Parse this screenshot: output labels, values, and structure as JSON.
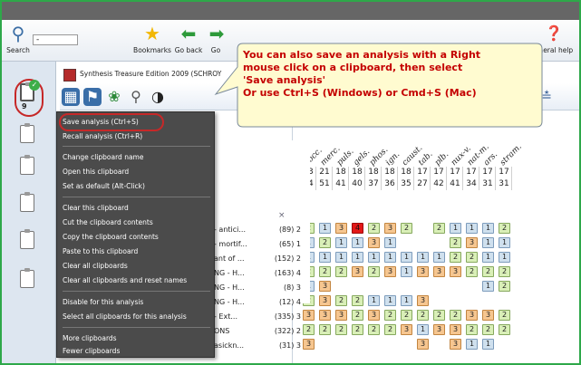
{
  "toolbar": {
    "search_label": "Search",
    "bookmarks_label": "Bookmarks",
    "go_back_label": "Go back",
    "go_label": "Go",
    "general_help_label": "eneral help"
  },
  "document": {
    "title": "Synthesis Treasure Edition 2009 (SCHROY"
  },
  "sidebar": {
    "active_clipboard_count": "9"
  },
  "context_menu": {
    "items": [
      "Save analysis (Ctrl+S)",
      "Recall analysis (Ctrl+R)",
      "Change clipboard name",
      "Open this clipboard",
      "Set as default (Alt-Click)",
      "Clear this clipboard",
      "Cut the clipboard contents",
      "Copy the clipboard contents",
      "Paste to this clipboard",
      "Clear all clipboards",
      "Clear all clipboards and reset names",
      "Disable for this analysis",
      "Select all clipboards for this analysis",
      "More clipboards",
      "Fewer clipboards"
    ]
  },
  "callout": {
    "line1": "You can also save an analysis with a Right",
    "line2": "mouse click on a clipboard, then select",
    "line3": "'Save analysis'",
    "line4": "Or use Ctrl+S (Windows) or Cmd+S (Mac)"
  },
  "remedy_abbrevs": [
    "cocc.",
    "merc.",
    "puls.",
    "gels.",
    "phos.",
    "ign.",
    "caust.",
    "tab.",
    "plb.",
    "nux-v.",
    "nat-m.",
    "ars.",
    "stram."
  ],
  "totals_row": [
    "23",
    "21",
    "18",
    "18",
    "18",
    "18",
    "18",
    "17",
    "17",
    "17",
    "17",
    "17",
    "17"
  ],
  "rubric_count_row": [
    "44",
    "51",
    "41",
    "40",
    "37",
    "36",
    "35",
    "27",
    "42",
    "41",
    "34",
    "31",
    "31"
  ],
  "close_x": "×",
  "rubrics": [
    {
      "name": "- antici...",
      "count": "(89) 2",
      "cells": [
        "2",
        "1",
        "3",
        "4",
        "2",
        "3",
        "2",
        "",
        "2",
        "1",
        "1",
        "1",
        "2"
      ]
    },
    {
      "name": "- mortif...",
      "count": "(65) 1",
      "cells": [
        "1",
        "2",
        "1",
        "1",
        "3",
        "1",
        "",
        "",
        "",
        "2",
        "3",
        "1",
        "1"
      ]
    },
    {
      "name": "ant of ...",
      "count": "(152) 2",
      "cells": [
        "1",
        "1",
        "1",
        "1",
        "1",
        "1",
        "1",
        "1",
        "1",
        "2",
        "2",
        "1",
        "1"
      ]
    },
    {
      "name": "NG - H...",
      "count": "(163) 4",
      "cells": [
        "2",
        "2",
        "2",
        "3",
        "2",
        "3",
        "1",
        "3",
        "3",
        "3",
        "2",
        "2",
        "2"
      ]
    },
    {
      "name": "NG - H...",
      "count": "(8) 3",
      "cells": [
        "1",
        "3",
        "",
        "",
        "",
        "",
        "",
        "",
        "",
        "",
        "",
        "1",
        "2"
      ]
    },
    {
      "name": "NG - H...",
      "count": "(12) 4",
      "cells": [
        "2",
        "3",
        "2",
        "2",
        "1",
        "1",
        "1",
        "3",
        "",
        "",
        "",
        "",
        ""
      ]
    },
    {
      "name": "- Ext...",
      "count": "(335) 3",
      "cells": [
        "3",
        "3",
        "3",
        "2",
        "3",
        "2",
        "2",
        "2",
        "2",
        "2",
        "3",
        "3",
        "2"
      ]
    },
    {
      "name": "ONS",
      "count": "(322) 2",
      "cells": [
        "2",
        "2",
        "2",
        "2",
        "2",
        "2",
        "3",
        "1",
        "3",
        "3",
        "2",
        "2",
        "2"
      ]
    },
    {
      "name": "asickn...",
      "count": "(31) 3",
      "cells": [
        "3",
        "",
        "",
        "",
        "",
        "",
        "",
        "3",
        "",
        "3",
        "1",
        "1",
        ""
      ]
    }
  ]
}
